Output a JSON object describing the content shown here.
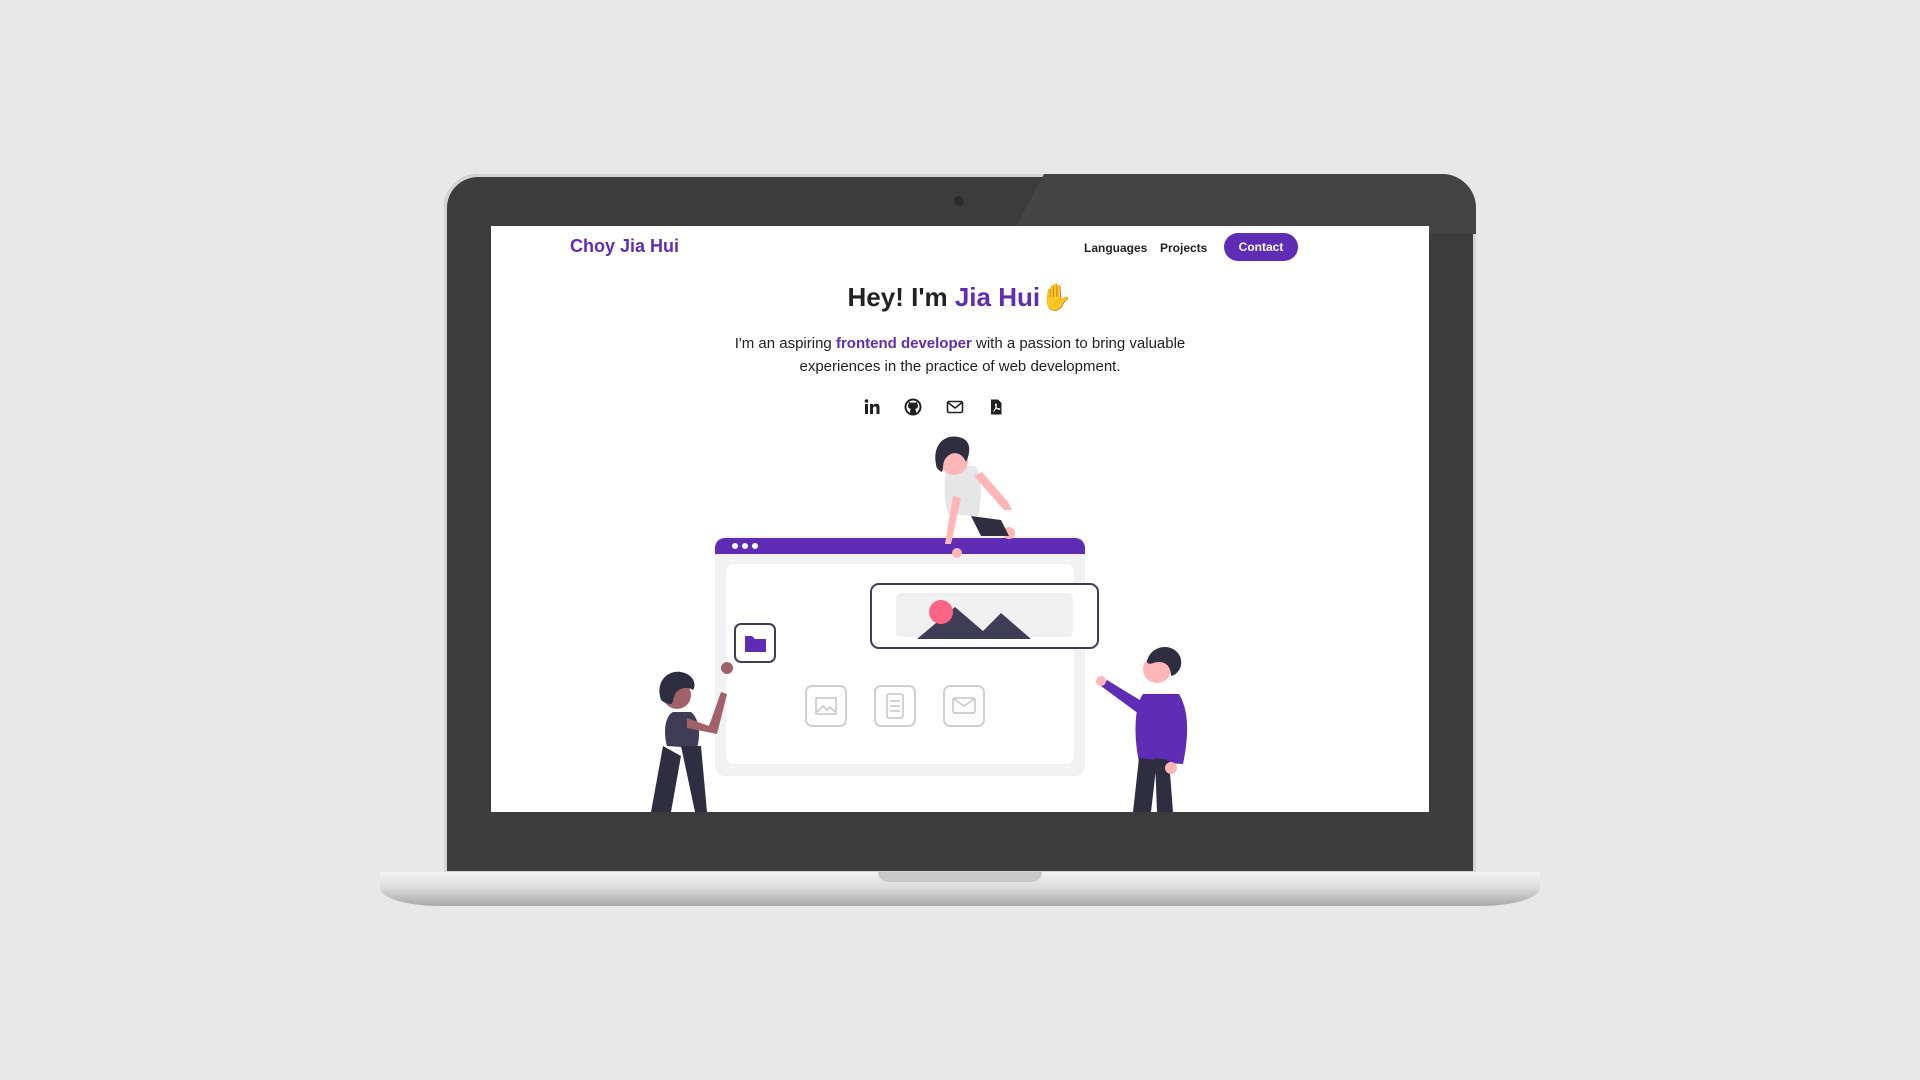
{
  "site": {
    "brand": "Choy Jia Hui",
    "nav": {
      "languages": "Languages",
      "projects": "Projects",
      "contact": "Contact"
    },
    "hero": {
      "greeting_prefix": "Hey! I'm ",
      "name": "Jia Hui",
      "wave_emoji": "✋",
      "sub_prefix": "I'm an aspiring ",
      "sub_highlight": "frontend developer",
      "sub_suffix": " with a passion to bring valuable",
      "sub_line2": "experiences in the practice of web development."
    },
    "socials": [
      "linkedin-icon",
      "github-icon",
      "mail-icon",
      "pdf-icon"
    ]
  },
  "colors": {
    "accent": "#5f2db5",
    "background": "#e8e8e8",
    "laptop_bezel": "#3c3c3c"
  }
}
